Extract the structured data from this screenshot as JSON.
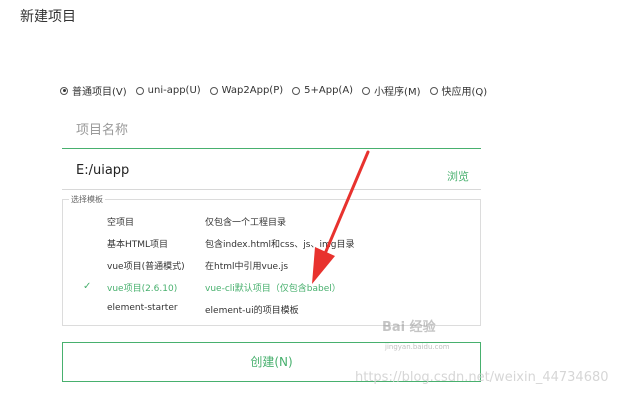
{
  "window": {
    "title": "新建项目"
  },
  "project_types": [
    {
      "label": "普通项目(V)",
      "checked": true
    },
    {
      "label": "uni-app(U)",
      "checked": false
    },
    {
      "label": "Wap2App(P)",
      "checked": false
    },
    {
      "label": "5+App(A)",
      "checked": false
    },
    {
      "label": "小程序(M)",
      "checked": false
    },
    {
      "label": "快应用(Q)",
      "checked": false
    }
  ],
  "project_name": {
    "placeholder": "项目名称",
    "value": ""
  },
  "project_path": {
    "value": "E:/uiapp",
    "browse_label": "浏览"
  },
  "template": {
    "legend": "选择模板",
    "items": [
      {
        "name": "空项目",
        "desc": "仅包含一个工程目录",
        "selected": false
      },
      {
        "name": "基本HTML项目",
        "desc": "包含index.html和css、js、img目录",
        "selected": false
      },
      {
        "name": "vue项目(普通模式)",
        "desc": "在html中引用vue.js",
        "selected": false
      },
      {
        "name": "vue项目(2.6.10)",
        "desc": "vue-cli默认项目（仅包含babel）",
        "selected": true,
        "check": "✓"
      },
      {
        "name": "element-starter",
        "desc": "element-ui的项目模板",
        "selected": false
      }
    ]
  },
  "create_button": {
    "label": "创建(N)"
  },
  "watermarks": {
    "baidu": "Bai 经验",
    "baidu_sub": "jingyan.baidu.com",
    "csdn": "https://blog.csdn.net/weixin_44734680"
  },
  "colors": {
    "accent": "#48b06e",
    "arrow": "#e8322e"
  }
}
